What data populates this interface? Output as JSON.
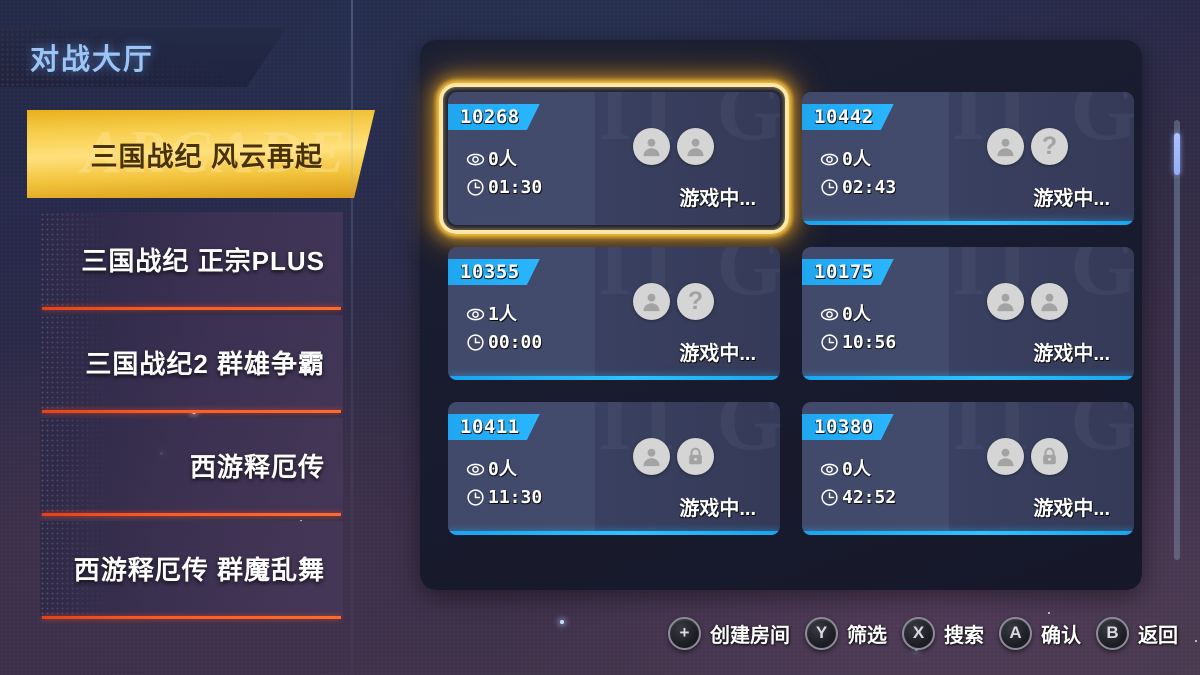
{
  "header": {
    "title": "对战大厅"
  },
  "sidebar": {
    "selected_index": 0,
    "items": [
      {
        "label": "三国战纪 风云再起",
        "watermark": "ARCADE",
        "selected": true
      },
      {
        "label": "三国战纪 正宗PLUS",
        "selected": false
      },
      {
        "label": "三国战纪2 群雄争霸",
        "selected": false
      },
      {
        "label": "西游释厄传",
        "selected": false
      },
      {
        "label": "西游释厄传 群魔乱舞",
        "selected": false
      }
    ]
  },
  "rooms": {
    "watermark_text": "II GU S",
    "selected_room_id": "10268",
    "cards": [
      {
        "id": "10268",
        "viewers": "0人",
        "timer": "01:30",
        "status": "游戏中...",
        "slots": [
          "player",
          "player"
        ],
        "selected": true
      },
      {
        "id": "10442",
        "viewers": "0人",
        "timer": "02:43",
        "status": "游戏中...",
        "slots": [
          "player",
          "question"
        ],
        "selected": false
      },
      {
        "id": "10355",
        "viewers": "1人",
        "timer": "00:00",
        "status": "游戏中...",
        "slots": [
          "player",
          "question"
        ],
        "selected": false
      },
      {
        "id": "10175",
        "viewers": "0人",
        "timer": "10:56",
        "status": "游戏中...",
        "slots": [
          "player",
          "player"
        ],
        "selected": false
      },
      {
        "id": "10411",
        "viewers": "0人",
        "timer": "11:30",
        "status": "游戏中...",
        "slots": [
          "player",
          "lock"
        ],
        "selected": false
      },
      {
        "id": "10380",
        "viewers": "0人",
        "timer": "42:52",
        "status": "游戏中...",
        "slots": [
          "player",
          "lock"
        ],
        "selected": false
      }
    ]
  },
  "scrollbar": {
    "thumb_position": "top"
  },
  "hints": [
    {
      "button": "+",
      "label": "创建房间"
    },
    {
      "button": "Y",
      "label": "筛选"
    },
    {
      "button": "X",
      "label": "搜索"
    },
    {
      "button": "A",
      "label": "确认"
    },
    {
      "button": "B",
      "label": "返回"
    }
  ],
  "colors": {
    "accent_cyan": "#2ab6ff",
    "accent_gold": "#ffe07c",
    "accent_red": "#e8401a",
    "title_blue": "#9cc4f5",
    "avatar_gray": "#d5d5d5"
  }
}
